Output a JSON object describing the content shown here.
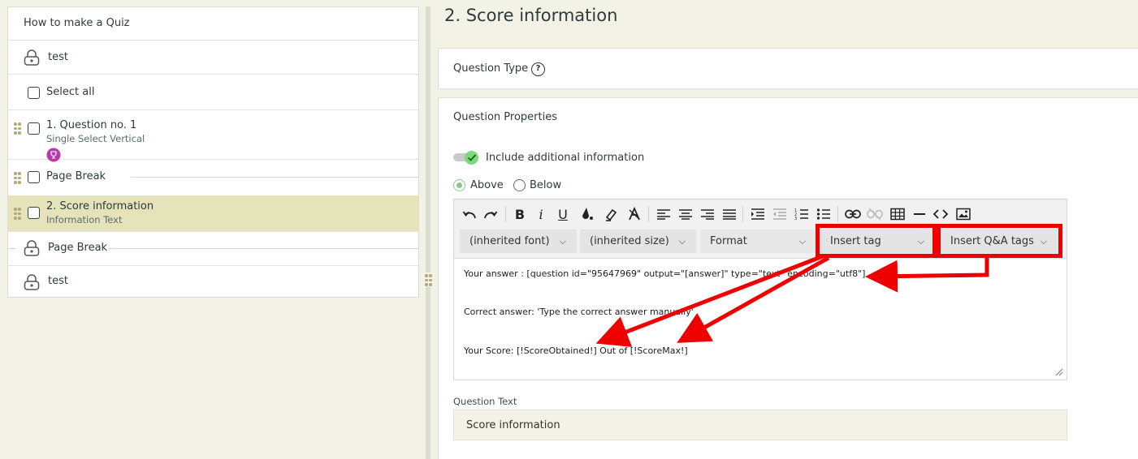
{
  "sidebar": {
    "quiz_title": "How to make a Quiz",
    "items": [
      {
        "label": "test"
      },
      {
        "label": "Select all"
      },
      {
        "label": "1.  Question no. 1",
        "sublabel": "Single Select Vertical"
      },
      {
        "label": "Page Break"
      },
      {
        "label": "2.  Score information",
        "sublabel": "Information Text"
      },
      {
        "label": "Page Break"
      },
      {
        "label": "test"
      }
    ]
  },
  "main": {
    "title": "2. Score information",
    "question_type_label": "Question Type",
    "question_type_help": "?",
    "properties_label": "Question Properties",
    "include_additional_info": "Include additional information",
    "position_options": [
      "Above",
      "Below"
    ],
    "selected_position": "Above"
  },
  "editor": {
    "dropdowns": [
      "(inherited font)",
      "(inherited size)",
      "Format",
      "Insert tag",
      "Insert Q&A tags"
    ],
    "content_lines": [
      "Your answer : [question id=\"95647969\" output=\"[answer]\" type=\"text\" encoding=\"utf8\"]",
      "Correct answer: 'Type the correct answer manually'",
      "Your Score: [!ScoreObtained!] Out of [!ScoreMax!]"
    ]
  },
  "question_text": {
    "label": "Question Text",
    "value": "Score information"
  },
  "colors": {
    "page_bg": "#f2f2e6",
    "selected_row": "#e4e3b9",
    "accent_green": "#7ed97a",
    "annotation_red": "#ee0000",
    "grip": "#b3a877"
  }
}
